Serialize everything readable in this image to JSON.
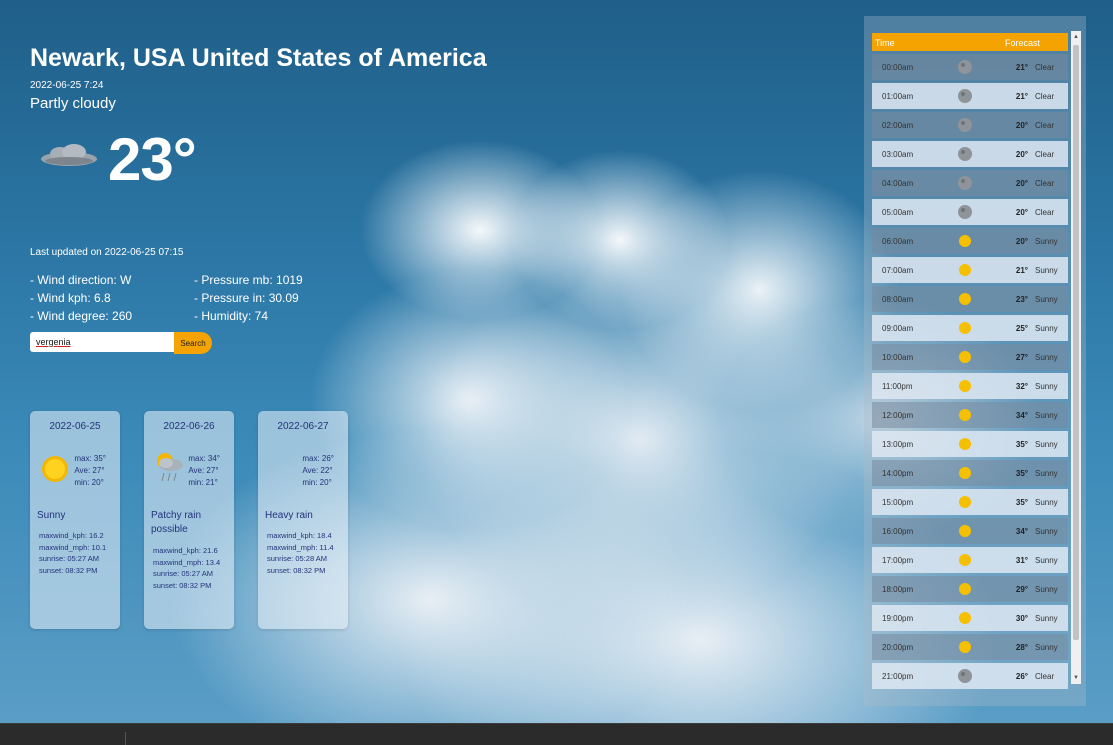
{
  "location": {
    "title": "Newark, USA United States of America",
    "local_time": "2022-06-25 7:24",
    "condition": "Partly cloudy",
    "temperature": "23°",
    "icon": "partly-cloudy-night-icon"
  },
  "updated": "Last updated on 2022-06-25 07:15",
  "stats": {
    "wind_direction": "- Wind direction: W",
    "wind_kph": "- Wind kph: 6.8",
    "wind_degree": "- Wind degree: 260",
    "pressure_mb": "- Pressure mb: 1019",
    "pressure_in": "- Pressure in: 30.09",
    "humidity": "- Humidity: 74"
  },
  "search": {
    "value": "vergenia",
    "button_label": "Search"
  },
  "days": [
    {
      "date": "2022-06-25",
      "max": "max: 35°",
      "avg": "Ave: 27°",
      "min": "min: 20°",
      "condition": "Sunny",
      "icon": "sun-icon",
      "maxwind_kph": "maxwind_kph: 16.2",
      "maxwind_mph": "maxwind_mph: 10.1",
      "sunrise": "sunrise: 05:27 AM",
      "sunset": "sunset: 08:32 PM"
    },
    {
      "date": "2022-06-26",
      "max": "max: 34°",
      "avg": "Ave: 27°",
      "min": "min: 21°",
      "condition": "Patchy rain possible",
      "icon": "patchy-rain-icon",
      "maxwind_kph": "maxwind_kph: 21.6",
      "maxwind_mph": "maxwind_mph: 13.4",
      "sunrise": "sunrise: 05:27 AM",
      "sunset": "sunset: 08:32 PM"
    },
    {
      "date": "2022-06-27",
      "max": "max: 26°",
      "avg": "Ave: 22°",
      "min": "min: 20°",
      "condition": "Heavy rain",
      "icon": "heavy-rain-icon",
      "maxwind_kph": "maxwind_kph: 18.4",
      "maxwind_mph": "maxwind_mph: 11.4",
      "sunrise": "sunrise: 05:28 AM",
      "sunset": "sunset: 08:32 PM"
    }
  ],
  "hourly": {
    "headers": {
      "time": "Time",
      "forecast": "Forecast"
    },
    "rows": [
      {
        "time": "00:00am",
        "temp": "21°",
        "cond": "Clear",
        "icon": "moon-icon"
      },
      {
        "time": "01:00am",
        "temp": "21°",
        "cond": "Clear",
        "icon": "moon-icon"
      },
      {
        "time": "02:00am",
        "temp": "20°",
        "cond": "Clear",
        "icon": "moon-icon"
      },
      {
        "time": "03:00am",
        "temp": "20°",
        "cond": "Clear",
        "icon": "moon-icon"
      },
      {
        "time": "04:00am",
        "temp": "20°",
        "cond": "Clear",
        "icon": "moon-icon"
      },
      {
        "time": "05:00am",
        "temp": "20°",
        "cond": "Clear",
        "icon": "moon-icon"
      },
      {
        "time": "06:00am",
        "temp": "20°",
        "cond": "Sunny",
        "icon": "sun-icon"
      },
      {
        "time": "07:00am",
        "temp": "21°",
        "cond": "Sunny",
        "icon": "sun-icon"
      },
      {
        "time": "08:00am",
        "temp": "23°",
        "cond": "Sunny",
        "icon": "sun-icon"
      },
      {
        "time": "09:00am",
        "temp": "25°",
        "cond": "Sunny",
        "icon": "sun-icon"
      },
      {
        "time": "10:00am",
        "temp": "27°",
        "cond": "Sunny",
        "icon": "sun-icon"
      },
      {
        "time": "11:00pm",
        "temp": "32°",
        "cond": "Sunny",
        "icon": "sun-icon"
      },
      {
        "time": "12:00pm",
        "temp": "34°",
        "cond": "Sunny",
        "icon": "sun-icon"
      },
      {
        "time": "13:00pm",
        "temp": "35°",
        "cond": "Sunny",
        "icon": "sun-icon"
      },
      {
        "time": "14:00pm",
        "temp": "35°",
        "cond": "Sunny",
        "icon": "sun-icon"
      },
      {
        "time": "15:00pm",
        "temp": "35°",
        "cond": "Sunny",
        "icon": "sun-icon"
      },
      {
        "time": "16:00pm",
        "temp": "34°",
        "cond": "Sunny",
        "icon": "sun-icon"
      },
      {
        "time": "17:00pm",
        "temp": "31°",
        "cond": "Sunny",
        "icon": "sun-icon"
      },
      {
        "time": "18:00pm",
        "temp": "29°",
        "cond": "Sunny",
        "icon": "sun-icon"
      },
      {
        "time": "19:00pm",
        "temp": "30°",
        "cond": "Sunny",
        "icon": "sun-icon"
      },
      {
        "time": "20:00pm",
        "temp": "28°",
        "cond": "Sunny",
        "icon": "sun-icon"
      },
      {
        "time": "21:00pm",
        "temp": "26°",
        "cond": "Clear",
        "icon": "moon-icon"
      }
    ]
  },
  "colors": {
    "accent": "#f4a300",
    "card_text": "#24327a"
  }
}
